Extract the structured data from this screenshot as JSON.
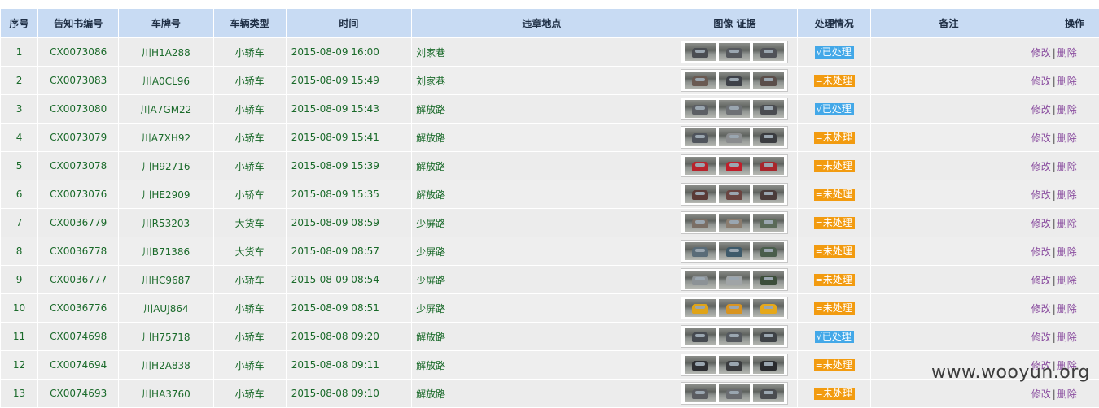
{
  "headers": {
    "seq": "序号",
    "notice_no": "告知书编号",
    "plate": "车牌号",
    "vehicle_type": "车辆类型",
    "time": "时间",
    "location": "违章地点",
    "evidence": "图像 证据",
    "status": "处理情况",
    "remarks": "备注",
    "ops": "操作"
  },
  "status_labels": {
    "done": "已处理",
    "todo": "未处理",
    "done_mark": "√",
    "todo_mark": "="
  },
  "actions": {
    "edit": "修改",
    "separator": "|",
    "delete": "删除"
  },
  "colors": {
    "header_bg": "#c8dbf3",
    "row_bg": "#ececec",
    "text_green": "#1a6a2a",
    "status_done": "#43a8e8",
    "status_todo": "#f29b10",
    "link_purple": "#8b4fa0"
  },
  "rows": [
    {
      "seq": "1",
      "notice_no": "CX0073086",
      "plate": "川H1A288",
      "type": "小轿车",
      "time": "2015-08-09 16:00",
      "location": "刘家巷",
      "status": "done",
      "car_colors": [
        "#4a4d52",
        "#55585d",
        "#505258"
      ]
    },
    {
      "seq": "2",
      "notice_no": "CX0073083",
      "plate": "川A0CL96",
      "type": "小轿车",
      "time": "2015-08-09 15:49",
      "location": "刘家巷",
      "status": "todo",
      "car_colors": [
        "#6a5a52",
        "#3e4148",
        "#5b4e4a"
      ]
    },
    {
      "seq": "3",
      "notice_no": "CX0073080",
      "plate": "川A7GM22",
      "type": "小轿车",
      "time": "2015-08-09 15:43",
      "location": "解放路",
      "status": "done",
      "car_colors": [
        "#5c5f64",
        "#6d7074",
        "#4a4c50"
      ]
    },
    {
      "seq": "4",
      "notice_no": "CX0073079",
      "plate": "川A7XH92",
      "type": "小轿车",
      "time": "2015-08-09 15:41",
      "location": "解放路",
      "status": "todo",
      "car_colors": [
        "#4f545c",
        "#8a8c8e",
        "#3a3c40"
      ]
    },
    {
      "seq": "5",
      "notice_no": "CX0073078",
      "plate": "川H92716",
      "type": "小轿车",
      "time": "2015-08-09 15:39",
      "location": "解放路",
      "status": "todo",
      "car_colors": [
        "#b8242c",
        "#c01e2a",
        "#a8262c"
      ]
    },
    {
      "seq": "6",
      "notice_no": "CX0073076",
      "plate": "川HE2909",
      "type": "小轿车",
      "time": "2015-08-09 15:35",
      "location": "解放路",
      "status": "todo",
      "car_colors": [
        "#5a3a36",
        "#6a4440",
        "#4a3c3a"
      ]
    },
    {
      "seq": "7",
      "notice_no": "CX0036779",
      "plate": "川R53203",
      "type": "大货车",
      "time": "2015-08-09 08:59",
      "location": "少屏路",
      "status": "todo",
      "car_colors": [
        "#7a6e64",
        "#8a7c6e",
        "#5a6a58"
      ]
    },
    {
      "seq": "8",
      "notice_no": "CX0036778",
      "plate": "川B71386",
      "type": "大货车",
      "time": "2015-08-09 08:57",
      "location": "少屏路",
      "status": "todo",
      "car_colors": [
        "#5a6c78",
        "#3e5a6a",
        "#4a5e4c"
      ]
    },
    {
      "seq": "9",
      "notice_no": "CX0036777",
      "plate": "川HC9687",
      "type": "小轿车",
      "time": "2015-08-09 08:54",
      "location": "少屏路",
      "status": "todo",
      "car_colors": [
        "#8c9296",
        "#a0a4a6",
        "#3c4e3a"
      ]
    },
    {
      "seq": "10",
      "notice_no": "CX0036776",
      "plate": "川AUJ864",
      "type": "小轿车",
      "time": "2015-08-09 08:51",
      "location": "少屏路",
      "status": "todo",
      "car_colors": [
        "#e0a418",
        "#d89420",
        "#e6a81a"
      ]
    },
    {
      "seq": "11",
      "notice_no": "CX0074698",
      "plate": "川H75718",
      "type": "小轿车",
      "time": "2015-08-08 09:20",
      "location": "解放路",
      "status": "done",
      "car_colors": [
        "#464a50",
        "#54585e",
        "#3e4246"
      ]
    },
    {
      "seq": "12",
      "notice_no": "CX0074694",
      "plate": "川H2A838",
      "type": "小轿车",
      "time": "2015-08-08 09:11",
      "location": "解放路",
      "status": "todo",
      "car_colors": [
        "#2e2f32",
        "#3a3b3e",
        "#2a2b2e"
      ]
    },
    {
      "seq": "13",
      "notice_no": "CX0074693",
      "plate": "川HA3760",
      "type": "小轿车",
      "time": "2015-08-08 09:10",
      "location": "解放路",
      "status": "todo",
      "car_colors": [
        "#5a5c60",
        "#6a6c70",
        "#4a4c50"
      ]
    }
  ],
  "watermark": "www.wooyun.org"
}
